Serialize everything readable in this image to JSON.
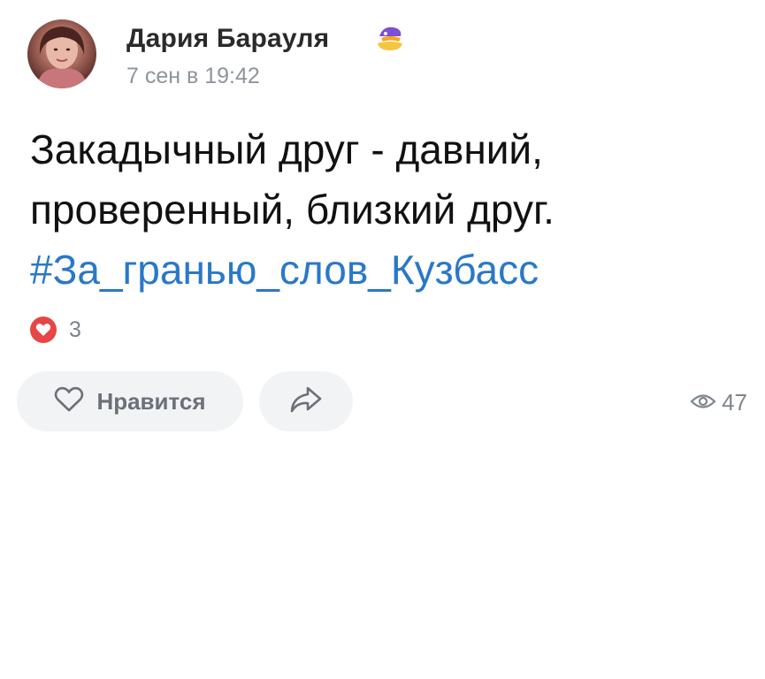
{
  "post": {
    "author_name": "Дария Барауля",
    "date": "7 сен в 19:42",
    "text_lines": [
      "Закадычный друг - давний,",
      "проверенный, близкий друг."
    ],
    "hashtag": "#За_гранью_слов_Кузбасс",
    "reactions_count": "3",
    "views_count": "47"
  },
  "actions": {
    "like_label": "Нравится"
  },
  "icons": {
    "reaction": "heart-icon",
    "like": "heart-outline-icon",
    "share": "share-arrow-icon",
    "views": "eye-icon",
    "badge": "emoji-badge-icon"
  },
  "colors": {
    "hashtag": "#2a78c7",
    "reaction_heart": "#e64646",
    "secondary_text": "#8e949c",
    "button_bg": "#f2f3f5"
  }
}
